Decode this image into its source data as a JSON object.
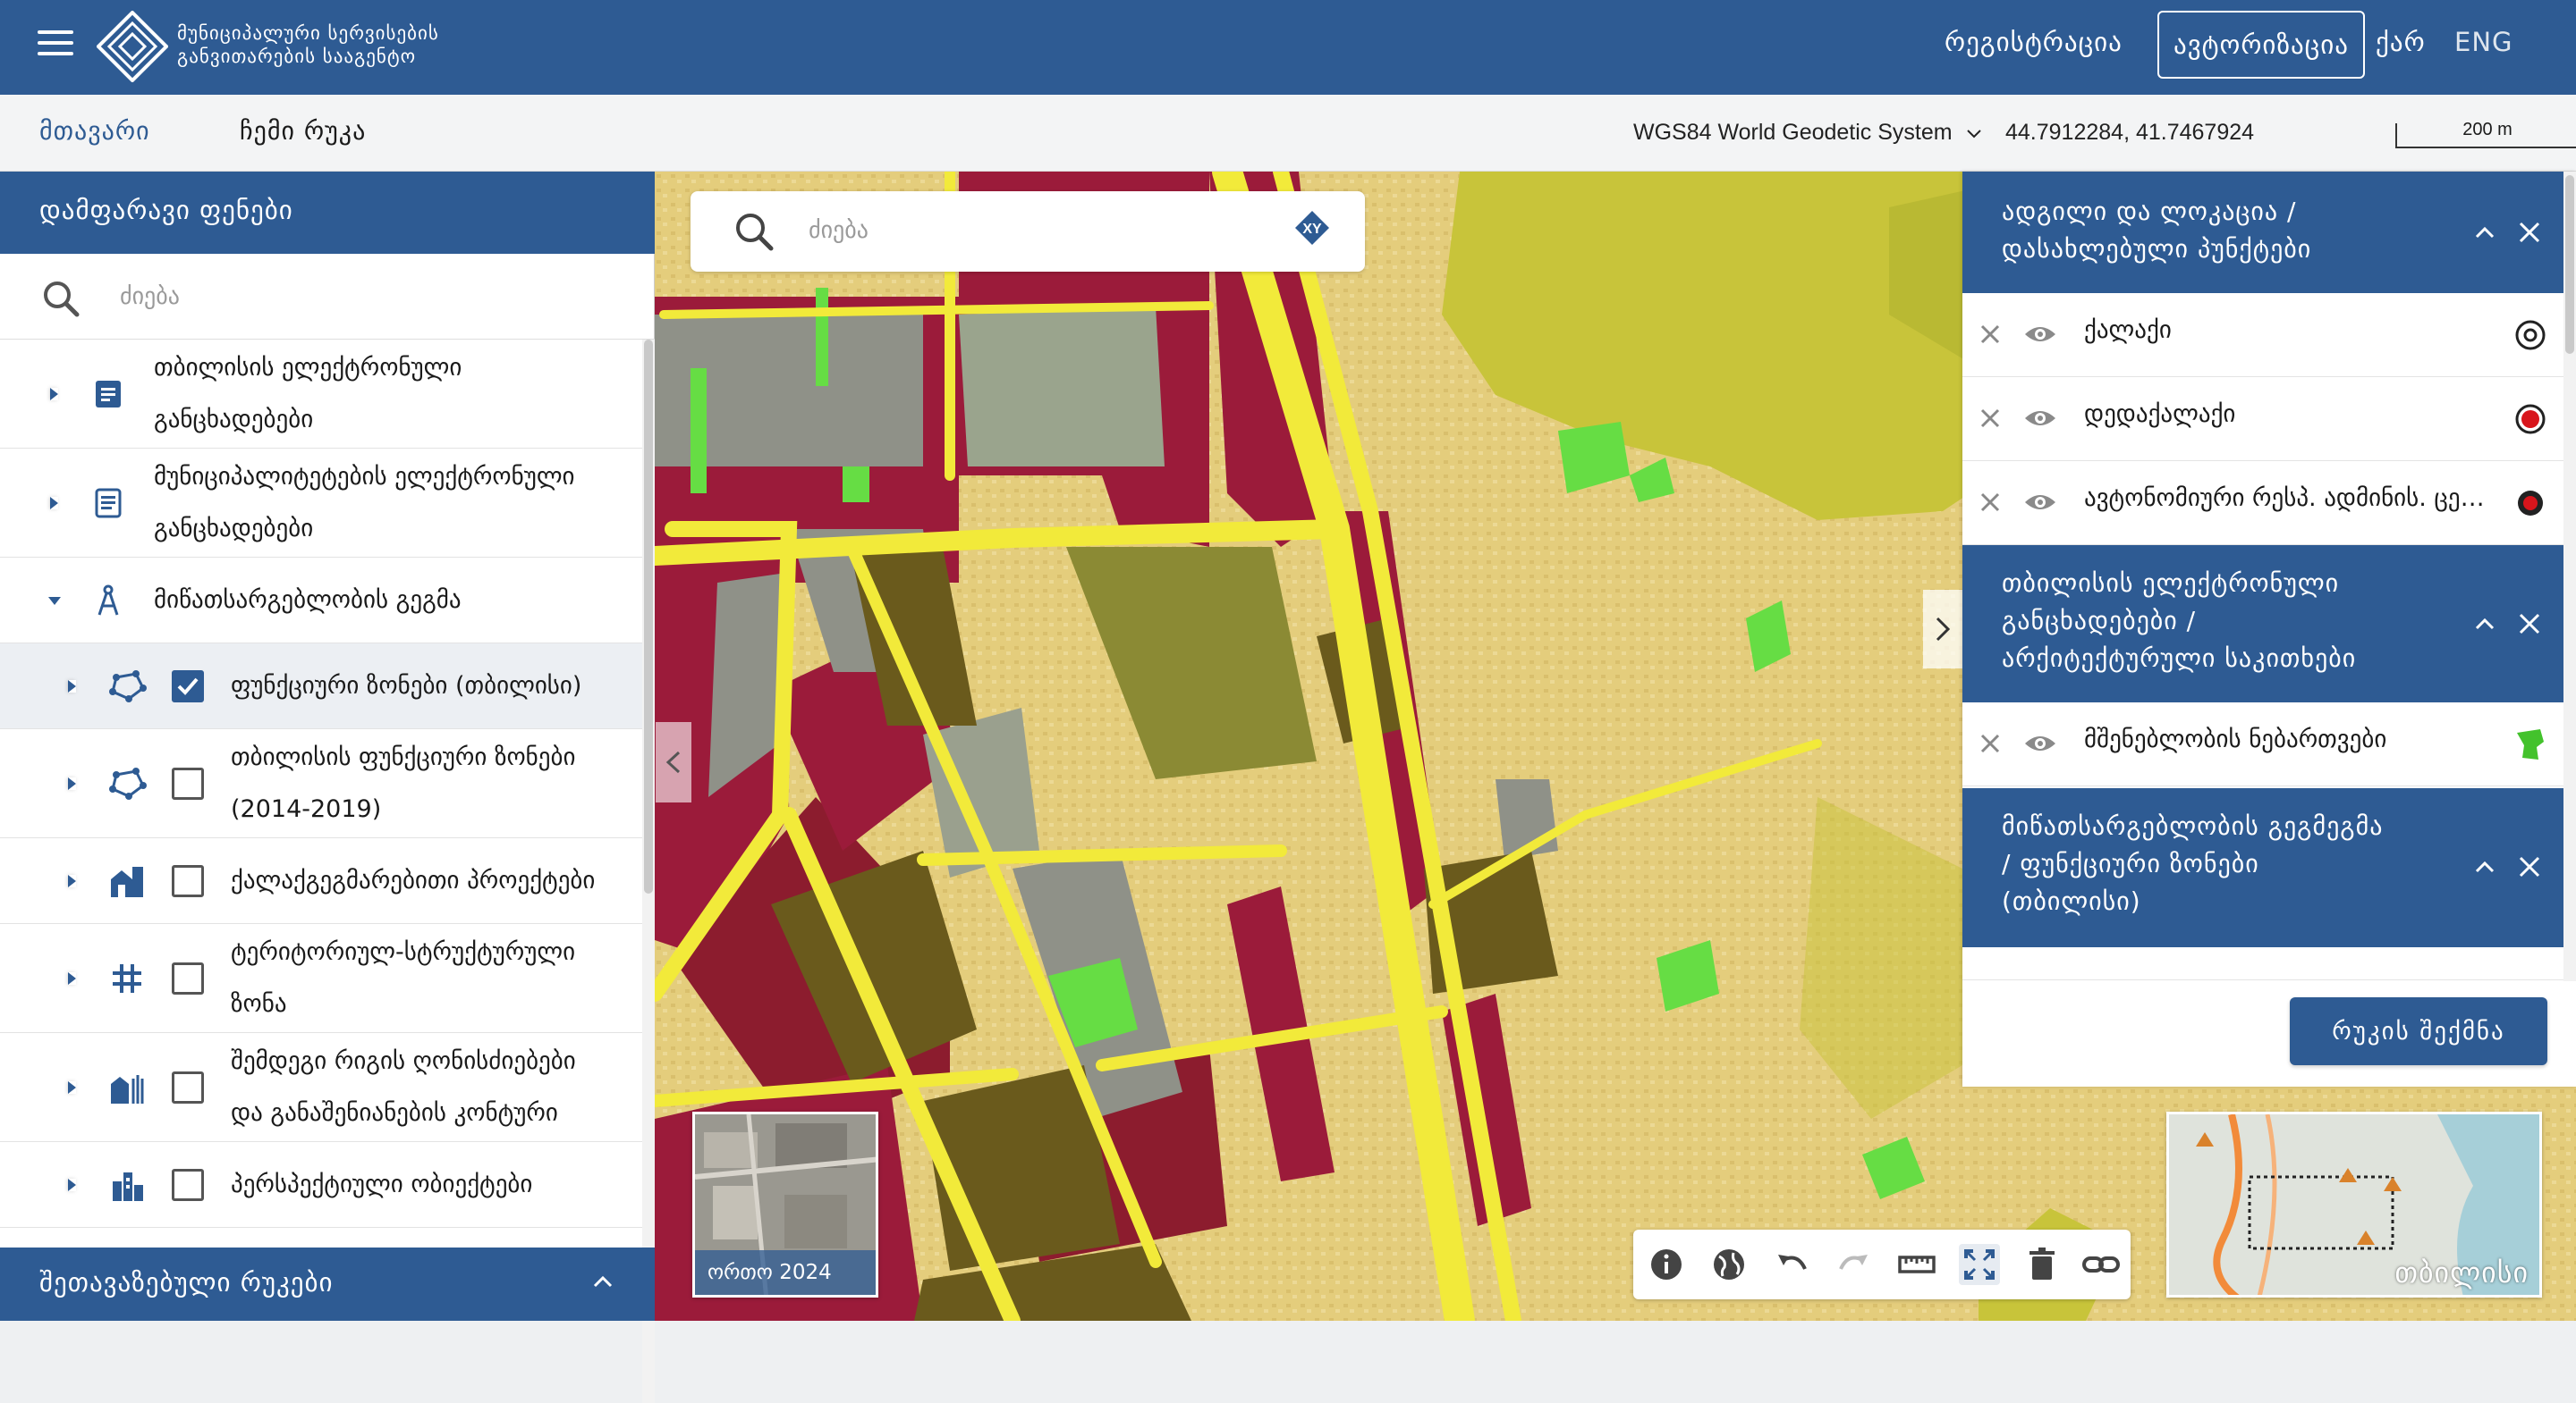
{
  "header": {
    "org_line1": "მუნიციპალური სერვისების",
    "org_line2": "განვითარების სააგენტო",
    "register": "რეგისტრაცია",
    "login": "ავტორიზაცია",
    "lang_ka": "ქარ",
    "lang_en": "ENG"
  },
  "subbar": {
    "tab_main": "მთავარი",
    "tab_mymap": "ჩემი რუკა",
    "crs": "WGS84 World Geodetic System",
    "coords": "44.7912284, 41.7467924",
    "scale": "200 m"
  },
  "left_panel": {
    "title": "დამფარავი ფენები",
    "search_placeholder": "ძიება",
    "items": [
      {
        "line1": "თბილისის ელექტრონული",
        "line2": "განცხადებები",
        "icon": "document-icon"
      },
      {
        "line1": "მუნიციპალიტეტების ელექტრონული",
        "line2": "განცხადებები",
        "icon": "document-list-icon"
      },
      {
        "label": "მიწათსარგებლობის გეგმა",
        "icon": "compass-icon",
        "expanded": true
      },
      {
        "label": "ფუნქციური ზონები (თბილისი)",
        "icon": "polygon-layer-icon",
        "checked": true
      },
      {
        "line1": "თბილისის ფუნქციური ზონები",
        "line2": "(2014-2019)",
        "icon": "polygon-layer-icon",
        "checked": false
      },
      {
        "label": "ქალაქგეგმარებითი პროექტები",
        "icon": "buildings-icon",
        "checked": false
      },
      {
        "line1": "ტერიტორიულ-სტრუქტურული",
        "line2": "ზონა",
        "icon": "grid-icon",
        "checked": false
      },
      {
        "line1": "შემდეგი რიგის ღონისძიებები",
        "line2": "და განაშენიანების კონტური",
        "icon": "building-lines-icon",
        "checked": false
      },
      {
        "label": "პერსპექტიული ობიექტები",
        "icon": "city-icon",
        "checked": false
      }
    ],
    "footer": "შეთავაზებული რუკები"
  },
  "map": {
    "search_placeholder": "ძიება",
    "xy_label": "XY",
    "ortho_caption": "ორთო 2024",
    "overview_caption": "თბილისი"
  },
  "right_panel": {
    "sections": [
      {
        "title_line1": "ადგილი და ლოკაცია /",
        "title_line2": "დასახლებული პუნქტები"
      },
      {
        "title_line1": "თბილისის ელექტრონული",
        "title_line2": "განცხადებები /",
        "title_line3": "არქიტექტურული საკითხები"
      },
      {
        "title_line1": "მიწათსარგებლობის გეგმეგმა",
        "title_line2": "/ ფუნქციური ზონები",
        "title_line3": "(თბილისი)"
      }
    ],
    "items": [
      {
        "label": "ქალაქი",
        "symbol": "circle-outline"
      },
      {
        "label": "დედაქალაქი",
        "symbol": "circle-red"
      },
      {
        "label": "ავტონომიური რესპ. ადმინის. ცენტრი",
        "symbol": "circle-red"
      },
      {
        "label": "მშენებლობის ნებართვები",
        "symbol": "green-polygon"
      }
    ],
    "make_map": "რუკის შექმნა"
  },
  "colors": {
    "brand": "#2e5b93",
    "zone_yellow": "#e7d07a",
    "road_yellow": "#f2ea3a",
    "zone_red": "#9b1b3a",
    "zone_olive": "#6a5a1c",
    "zone_green": "#66dd44",
    "zone_purple": "#a8508e"
  }
}
